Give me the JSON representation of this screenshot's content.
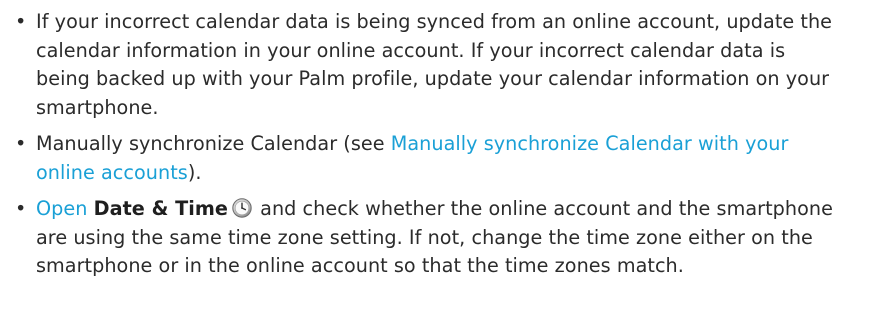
{
  "bullets": {
    "one": {
      "text": "If your incorrect calendar data is being synced from an online account, update the calendar information in your online account. If your incorrect calendar data is being backed up with your Palm profile, update your calendar information on your smartphone."
    },
    "two": {
      "text_before": "Manually synchronize Calendar (see ",
      "link": "Manually synchronize Calendar with your online accounts",
      "text_after": ")."
    },
    "three": {
      "link_open": "Open",
      "app_name": "Date & Time",
      "icon": "clock-icon",
      "text_after": " and check whether the online account and the smartphone are using the same time zone setting. If not, change the time zone either on the smartphone or in the online account so that the time zones match."
    }
  },
  "colors": {
    "text": "#2b2b2b",
    "link": "#1aa0d6"
  }
}
